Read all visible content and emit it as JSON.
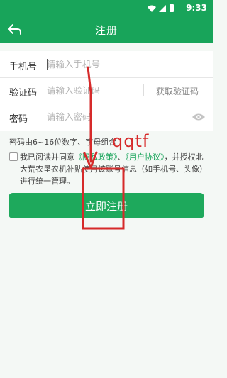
{
  "status_bar": {
    "time": "9:33",
    "icons": [
      "wifi-icon",
      "signal-icon",
      "battery-icon"
    ]
  },
  "app_bar": {
    "title": "注册",
    "back_icon": "back-arrow-icon"
  },
  "form": {
    "phone": {
      "label": "手机号",
      "placeholder": "请输入手机号"
    },
    "code": {
      "label": "验证码",
      "placeholder": "请输入验证码",
      "action": "获取验证码"
    },
    "password": {
      "label": "密码",
      "placeholder": "请输入密码",
      "toggle_icon": "eye-icon"
    }
  },
  "password_hint": "密码由6~16位数字、字母组合",
  "agreement": {
    "prefix": "我已阅读并同意",
    "privacy_link": "《隐私政策》",
    "sep": "、",
    "terms_link": "《用户协议》",
    "suffix": "，并授权北大荒农垦农机补贴使用该账号信息（如手机号、头像）进行统一管理。",
    "checked": false
  },
  "submit_label": "立即注册",
  "annotation": {
    "text": "qqtf",
    "color": "#d62a2a"
  },
  "colors": {
    "primary": "#18a45a",
    "link": "#18a45a",
    "background": "#f4f8f5"
  }
}
